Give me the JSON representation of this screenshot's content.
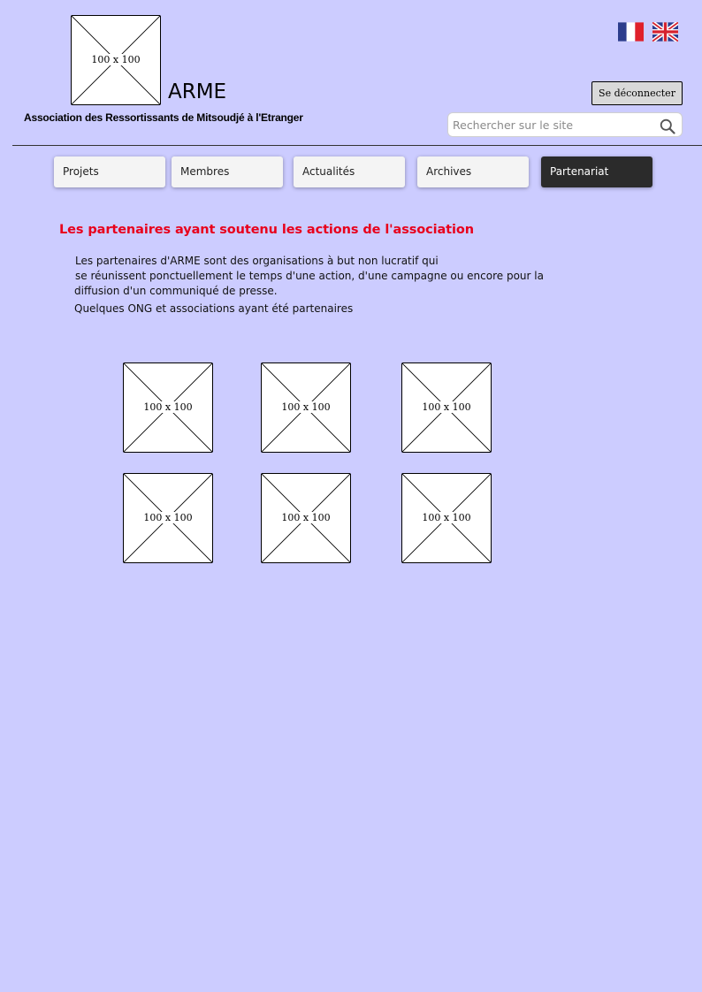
{
  "header": {
    "logo_placeholder": "100 x 100",
    "title": "ARME",
    "subtitle": "Association des Ressortissants de Mitsoudjé à l'Etranger",
    "languages": [
      {
        "code": "fr",
        "icon": "flag-fr-icon"
      },
      {
        "code": "en",
        "icon": "flag-uk-icon"
      }
    ],
    "logout_label": "Se déconnecter",
    "search": {
      "placeholder": "Rechercher sur le site",
      "value": "",
      "icon": "search-icon"
    }
  },
  "nav": {
    "tabs": [
      {
        "label": "Projets",
        "active": false
      },
      {
        "label": "Membres",
        "active": false
      },
      {
        "label": "Actualités",
        "active": false
      },
      {
        "label": "Archives",
        "active": false
      },
      {
        "label": "Partenariat",
        "active": true
      }
    ]
  },
  "main": {
    "title": "Les partenaires ayant soutenu les actions de l'association",
    "intro_lines": [
      "Les partenaires d'ARME sont des organisations à but non lucratif qui",
      "se réunissent ponctuellement le temps d'une action, d'une campagne ou encore pour la",
      "diffusion d'un communiqué de presse.",
      "Quelques ONG et associations ayant été partenaires"
    ],
    "partners": [
      {
        "placeholder": "100 x 100"
      },
      {
        "placeholder": "100 x 100"
      },
      {
        "placeholder": "100 x 100"
      },
      {
        "placeholder": "100 x 100"
      },
      {
        "placeholder": "100 x 100"
      },
      {
        "placeholder": "100 x 100"
      }
    ]
  },
  "colors": {
    "background": "#ccccff",
    "title_red": "#e8001c",
    "active_tab": "#2b2b2b",
    "tab": "#f4f4f4",
    "button": "#d9d9d9"
  }
}
